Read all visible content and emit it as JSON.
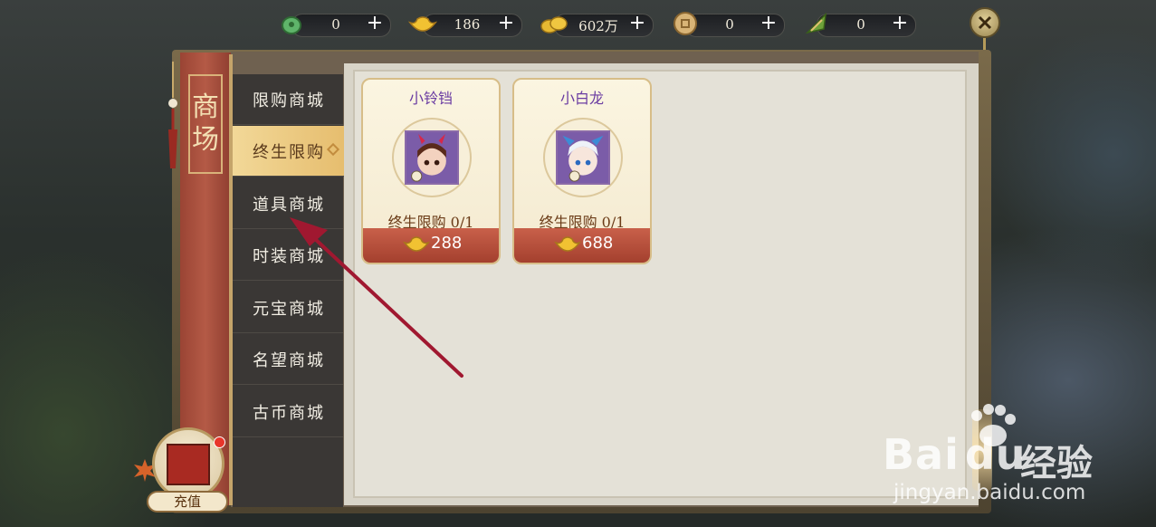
{
  "currencies": [
    {
      "icon": "jade-coin-icon",
      "value": "0",
      "plus": "+"
    },
    {
      "icon": "gold-ingot-icon",
      "value": "186",
      "plus": "+"
    },
    {
      "icon": "gold-coins-icon",
      "value": "602万",
      "plus": "+"
    },
    {
      "icon": "copper-coin-icon",
      "value": "0",
      "plus": "+"
    },
    {
      "icon": "zongzi-icon",
      "value": "0",
      "plus": "+"
    }
  ],
  "panel": {
    "title_chars": [
      "商",
      "场"
    ]
  },
  "menu": {
    "items": [
      {
        "label": "限购商城",
        "active": false
      },
      {
        "label": "终生限购",
        "active": true
      },
      {
        "label": "道具商城",
        "active": false
      },
      {
        "label": "时装商城",
        "active": false
      },
      {
        "label": "元宝商城",
        "active": false
      },
      {
        "label": "名望商城",
        "active": false
      },
      {
        "label": "古币商城",
        "active": false
      }
    ]
  },
  "items": [
    {
      "name": "小铃铛",
      "limit": "终生限购 0/1",
      "price": "288"
    },
    {
      "name": "小白龙",
      "limit": "终生限购 0/1",
      "price": "688"
    }
  ],
  "recharge": {
    "label": "充值"
  },
  "watermark": {
    "logo": "Bai",
    "logo_tail": "du",
    "cn": "经验",
    "url": "jingyan.baidu.com"
  },
  "colors": {
    "active_tab": "#f2d898",
    "price_bar": "#b04a36",
    "item_name": "#6a3ca2",
    "arrow": "#a01830"
  }
}
